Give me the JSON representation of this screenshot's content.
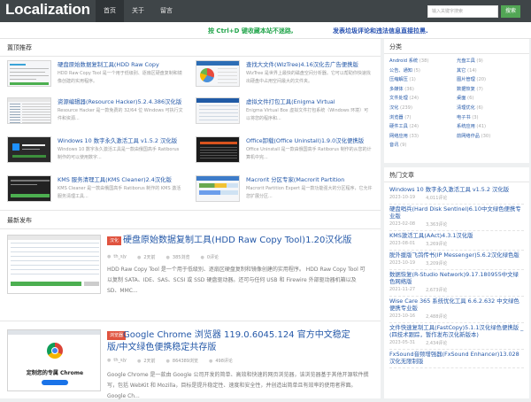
{
  "header": {
    "logo": "Localization",
    "nav": [
      "首页",
      "关于",
      "留言"
    ],
    "search_placeholder": "输入关键字搜索",
    "search_button": "搜索"
  },
  "notice": {
    "left": "按 Ctrl+D 键收藏本站不迷路,",
    "right": "发表垃圾评论和违法信息直接拉黑."
  },
  "pinned": {
    "heading": "置顶推荐",
    "items": [
      {
        "title": "硬盘原始数据复制工具(HDD Raw Copy",
        "desc": "HDD Raw Copy Tool 是一个用于低级别、逐扇区硬盘复制和镜像创建的实用程序。"
      },
      {
        "title": "查找大文件(WizTree)4.16汉化去广告便携版",
        "desc": "WizTree 是世界上最快的磁盘空间分析器。它可以帮助你快速找出硬盘中占用空间最大的文件夹。"
      },
      {
        "title": "资源编辑器(Resource Hacker)5.2.4.386汉化版",
        "desc": "Resource Hacker 是一款免费的 32/64 位 Windows 可执行文件和资源..."
      },
      {
        "title": "虚拟文件打包工具(Enigma Virtual",
        "desc": "Enigma Virtual Box 虚拟文件打包系统（Windows 环境）可以将您的程序和..."
      },
      {
        "title": "Windows 10 数字永久激活工具 v1.5.2 汉化版",
        "desc": "Windows 10 数字永久激活工具是一款由俄国高手 Ratiborus 制作的可以使用数字..."
      },
      {
        "title": "Office卸载(Office Uninstall)1.9.0汉化便携版",
        "desc": "Office Uninstall 是一款由俄国高手 Ratiborus 制作的从您的计算机中完..."
      },
      {
        "title": "KMS 服务清理工具(KMS Cleaner)2.4汉化版",
        "desc": "KMS Cleaner 是一款由俄国高手 Ratiborus 制作的 KMS 激活服务清理工具..."
      },
      {
        "title": "Macrorit 分区专家(Macrorit Partition",
        "desc": "Macrorit Partition Expert 是一款功能强大的分区程序，它允许您扩展分区..."
      }
    ]
  },
  "latest": {
    "heading": "最新发布",
    "posts": [
      {
        "tag": "汉化",
        "title": "硬盘原始数据复制工具(HDD Raw Copy Tool)1.20汉化版",
        "author": "th_sjy",
        "date": "2天前",
        "views": "385浏览",
        "comments": "0评论",
        "desc": "HDD Raw Copy Tool 是一个用于低级别、逐扇区硬盘复制和镜像创建的实用程序。 HDD Raw Copy Tool 可以复制 SATA、IDE、SAS、SCSI 或 SSD 硬盘驱动器。还可与任何 USB 和 Firewire 外部驱动器机箱以及 SD、MMC..."
      },
      {
        "tag": "浏览器",
        "title": "Google Chrome 浏览器 119.0.6045.124 官方中文稳定版/中文绿色便携稳定共存版",
        "author": "th_sjy",
        "date": "2天前",
        "views": "864389浏览",
        "comments": "498评论",
        "desc": "Google Chrome 是一款由 Google 公司开发的简单、高效和快速的网页浏览器，该浏览器基于其他开源软件撰写，包括 WebKit 和 Mozilla，目标是提升稳定性、速度和安全性，并创造出简单且有效率的使用者界面。 Google Ch...",
        "thumb_caption": "定制您的专属 Chrome"
      }
    ]
  },
  "sidebar": {
    "categories": {
      "heading": "分类",
      "items": [
        {
          "name": "Android 系统",
          "count": "(38)"
        },
        {
          "name": "光盘工具",
          "count": "(9)"
        },
        {
          "name": "公告、通知",
          "count": "(5)"
        },
        {
          "name": "其它",
          "count": "(14)"
        },
        {
          "name": "压缩解压",
          "count": "(1)"
        },
        {
          "name": "图片管理",
          "count": "(20)"
        },
        {
          "name": "多媒体",
          "count": "(36)"
        },
        {
          "name": "数据恢复",
          "count": "(7)"
        },
        {
          "name": "文件处理",
          "count": "(24)"
        },
        {
          "name": "桌面",
          "count": "(6)"
        },
        {
          "name": "汉化",
          "count": "(239)"
        },
        {
          "name": "清理优化",
          "count": "(6)"
        },
        {
          "name": "浏览器",
          "count": "(7)"
        },
        {
          "name": "电子书",
          "count": "(3)"
        },
        {
          "name": "硬件工具",
          "count": "(24)"
        },
        {
          "name": "系统应用",
          "count": "(41)"
        },
        {
          "name": "网络应用",
          "count": "(33)"
        },
        {
          "name": "前网络作品",
          "count": "(30)"
        },
        {
          "name": "音讯",
          "count": "(9)"
        }
      ]
    },
    "hot": {
      "heading": "热门文章",
      "items": [
        {
          "title": "Windows 10 数字永久激活工具 v1.5.2 汉化版",
          "date": "2023-10-19",
          "comments": "4,011评论"
        },
        {
          "title": "硬盘哨兵(Hard Disk Sentinel)6.10中文绿色便携专业版",
          "date": "2023-02-08",
          "comments": "3,363评论"
        },
        {
          "title": "KMS激活工具(AAct)4.3.1汉化版",
          "date": "2023-08-01",
          "comments": "3,269评论"
        },
        {
          "title": "脱外援版飞鸽传书(IP Messenger)5.6.2汉化绿色版",
          "date": "2023-10-19",
          "comments": "3,209评论"
        },
        {
          "title": "数据恢复(R-Studio Network)9.17.180955中文绿色网络版",
          "date": "2021-11-27",
          "comments": "2,673评论"
        },
        {
          "title": "Wise Care 365 系统优化工具 6.6.2.632 中文绿色便携专业版",
          "date": "2023-10-16",
          "comments": "2,488评论"
        },
        {
          "title": "文件快速复制工具(FastCopy)5.1.1汉化绿色便携版 _ (四技术跟踪，暂作发布汉化新版本)",
          "date": "2023-05-31",
          "comments": "2,434评论"
        },
        {
          "title": "FxSound音频增强器(FxSound Enhancer)13.028汉化无限制版",
          "date": "",
          "comments": ""
        }
      ]
    }
  }
}
